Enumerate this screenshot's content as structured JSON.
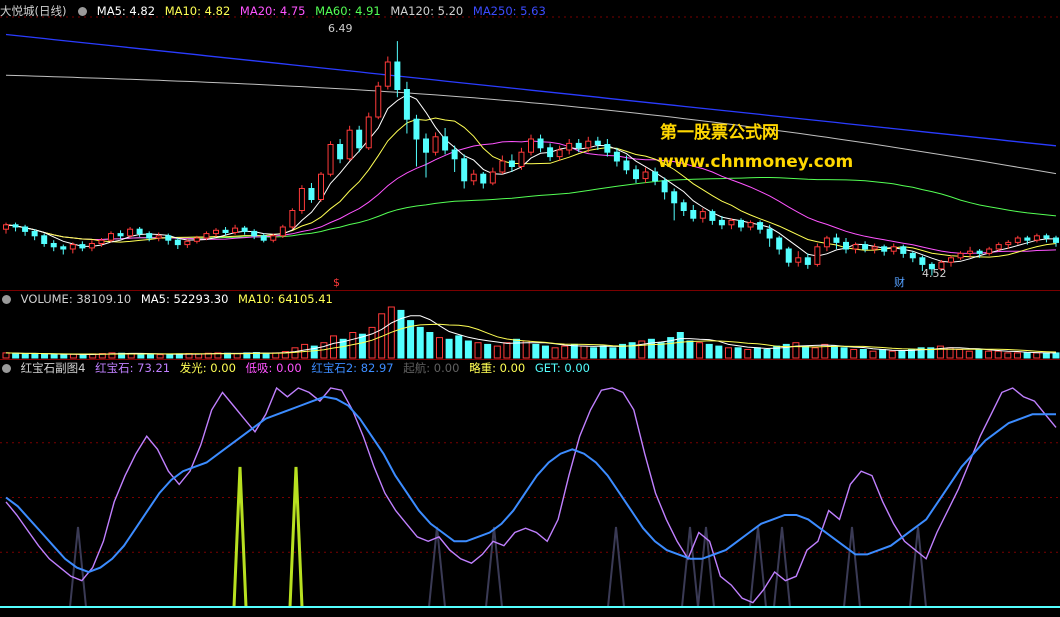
{
  "colors": {
    "background": "#000000",
    "up": "#ff3a3a",
    "down": "#54ffff",
    "ma5": "#ffffff",
    "ma10": "#ffff54",
    "ma20": "#ff54ff",
    "ma60": "#54ff54",
    "ma120": "#c0c0c0",
    "ma250": "#2a3cff"
  },
  "icons": {
    "legend_dot": "circle-icon"
  },
  "main": {
    "title": "大悦城(日线)",
    "legend": [
      {
        "label": "MA5: 4.82",
        "color": "#ffffff"
      },
      {
        "label": "MA10: 4.82",
        "color": "#ffff54"
      },
      {
        "label": "MA20: 4.75",
        "color": "#ff54ff"
      },
      {
        "label": "MA60: 4.91",
        "color": "#54ff54"
      },
      {
        "label": "MA120: 5.20",
        "color": "#d0d0d0"
      },
      {
        "label": "MA250: 5.63",
        "color": "#3c4cff"
      }
    ],
    "high_label": "6.49",
    "low_label": "4.52",
    "marker_s": "$",
    "marker_cai": "财",
    "watermark_cn": "第一股票公式网",
    "watermark_url": "www.chnmoney.com"
  },
  "volume": {
    "legend": [
      {
        "label": "VOLUME: 38109.10",
        "color": "#d0d0d0"
      },
      {
        "label": "MA5: 52293.30",
        "color": "#ffffff"
      },
      {
        "label": "MA10: 64105.41",
        "color": "#ffff54"
      }
    ]
  },
  "indicator": {
    "legend": [
      {
        "label": "红宝石副图4",
        "color": "#d0d0d0"
      },
      {
        "label": "红宝石: 73.21",
        "color": "#c080ff"
      },
      {
        "label": "发光: 0.00",
        "color": "#ffff54"
      },
      {
        "label": "低吸: 0.00",
        "color": "#ff54ff"
      },
      {
        "label": "红宝石2: 82.97",
        "color": "#3c8cff"
      },
      {
        "label": "起航: 0.00",
        "color": "#606060"
      },
      {
        "label": "略重: 0.00",
        "color": "#ffff54"
      },
      {
        "label": "GET: 0.00",
        "color": "#54ffff"
      }
    ]
  },
  "chart_data": [
    {
      "type": "candlestick",
      "title": "大悦城(日线)",
      "ylim": [
        4.3,
        6.7
      ],
      "annotations": {
        "max": 6.49,
        "min": 4.52
      },
      "candles": [
        [
          4.78,
          4.82,
          4.74,
          4.84
        ],
        [
          4.82,
          4.8,
          4.76,
          4.84
        ],
        [
          4.8,
          4.76,
          4.72,
          4.82
        ],
        [
          4.76,
          4.72,
          4.68,
          4.78
        ],
        [
          4.72,
          4.65,
          4.62,
          4.74
        ],
        [
          4.65,
          4.62,
          4.58,
          4.68
        ],
        [
          4.62,
          4.6,
          4.55,
          4.64
        ],
        [
          4.6,
          4.64,
          4.56,
          4.66
        ],
        [
          4.64,
          4.61,
          4.58,
          4.67
        ],
        [
          4.61,
          4.65,
          4.58,
          4.68
        ],
        [
          4.65,
          4.68,
          4.62,
          4.7
        ],
        [
          4.68,
          4.74,
          4.66,
          4.76
        ],
        [
          4.74,
          4.72,
          4.69,
          4.77
        ],
        [
          4.72,
          4.78,
          4.7,
          4.8
        ],
        [
          4.78,
          4.74,
          4.71,
          4.8
        ],
        [
          4.74,
          4.7,
          4.67,
          4.76
        ],
        [
          4.7,
          4.72,
          4.67,
          4.75
        ],
        [
          4.72,
          4.68,
          4.64,
          4.74
        ],
        [
          4.68,
          4.64,
          4.6,
          4.7
        ],
        [
          4.64,
          4.67,
          4.61,
          4.69
        ],
        [
          4.67,
          4.7,
          4.65,
          4.72
        ],
        [
          4.7,
          4.74,
          4.68,
          4.76
        ],
        [
          4.74,
          4.77,
          4.71,
          4.79
        ],
        [
          4.77,
          4.75,
          4.72,
          4.8
        ],
        [
          4.75,
          4.79,
          4.73,
          4.82
        ],
        [
          4.79,
          4.76,
          4.73,
          4.81
        ],
        [
          4.76,
          4.72,
          4.69,
          4.78
        ],
        [
          4.72,
          4.68,
          4.66,
          4.74
        ],
        [
          4.68,
          4.72,
          4.66,
          4.74
        ],
        [
          4.72,
          4.8,
          4.7,
          4.82
        ],
        [
          4.8,
          4.95,
          4.78,
          4.97
        ],
        [
          4.95,
          5.15,
          4.92,
          5.18
        ],
        [
          5.15,
          5.05,
          5.02,
          5.2
        ],
        [
          5.05,
          5.28,
          5.03,
          5.3
        ],
        [
          5.28,
          5.55,
          5.26,
          5.58
        ],
        [
          5.55,
          5.42,
          5.38,
          5.6
        ],
        [
          5.42,
          5.68,
          5.4,
          5.72
        ],
        [
          5.68,
          5.52,
          5.48,
          5.72
        ],
        [
          5.52,
          5.8,
          5.5,
          5.84
        ],
        [
          5.8,
          6.08,
          5.78,
          6.12
        ],
        [
          6.08,
          6.3,
          6.05,
          6.35
        ],
        [
          6.3,
          6.05,
          5.98,
          6.49
        ],
        [
          6.05,
          5.78,
          5.65,
          6.12
        ],
        [
          5.78,
          5.6,
          5.35,
          5.82
        ],
        [
          5.6,
          5.48,
          5.25,
          5.65
        ],
        [
          5.48,
          5.62,
          5.45,
          5.66
        ],
        [
          5.62,
          5.5,
          5.46,
          5.7
        ],
        [
          5.5,
          5.42,
          5.3,
          5.54
        ],
        [
          5.42,
          5.22,
          5.15,
          5.46
        ],
        [
          5.22,
          5.28,
          5.18,
          5.32
        ],
        [
          5.28,
          5.2,
          5.15,
          5.3
        ],
        [
          5.2,
          5.3,
          5.18,
          5.34
        ],
        [
          5.3,
          5.4,
          5.28,
          5.45
        ],
        [
          5.4,
          5.35,
          5.3,
          5.46
        ],
        [
          5.35,
          5.48,
          5.32,
          5.52
        ],
        [
          5.48,
          5.6,
          5.45,
          5.64
        ],
        [
          5.6,
          5.52,
          5.48,
          5.64
        ],
        [
          5.52,
          5.44,
          5.4,
          5.56
        ],
        [
          5.44,
          5.5,
          5.4,
          5.54
        ],
        [
          5.5,
          5.56,
          5.46,
          5.6
        ],
        [
          5.56,
          5.52,
          5.48,
          5.6
        ],
        [
          5.52,
          5.58,
          5.48,
          5.62
        ],
        [
          5.58,
          5.55,
          5.5,
          5.62
        ],
        [
          5.55,
          5.48,
          5.44,
          5.6
        ],
        [
          5.48,
          5.4,
          5.35,
          5.52
        ],
        [
          5.4,
          5.32,
          5.28,
          5.45
        ],
        [
          5.32,
          5.24,
          5.2,
          5.36
        ],
        [
          5.24,
          5.3,
          5.2,
          5.34
        ],
        [
          5.3,
          5.22,
          5.18,
          5.34
        ],
        [
          5.22,
          5.12,
          5.05,
          5.25
        ],
        [
          5.12,
          5.02,
          4.86,
          5.15
        ],
        [
          5.02,
          4.95,
          4.9,
          5.05
        ],
        [
          4.95,
          4.88,
          4.85,
          5.0
        ],
        [
          4.88,
          4.94,
          4.84,
          4.97
        ],
        [
          4.94,
          4.86,
          4.82,
          4.96
        ],
        [
          4.86,
          4.82,
          4.78,
          4.9
        ],
        [
          4.82,
          4.86,
          4.78,
          4.88
        ],
        [
          4.86,
          4.8,
          4.76,
          4.88
        ],
        [
          4.8,
          4.84,
          4.77,
          4.86
        ],
        [
          4.84,
          4.78,
          4.74,
          4.86
        ],
        [
          4.78,
          4.7,
          4.62,
          4.82
        ],
        [
          4.7,
          4.6,
          4.55,
          4.72
        ],
        [
          4.6,
          4.48,
          4.44,
          4.62
        ],
        [
          4.48,
          4.52,
          4.44,
          4.58
        ],
        [
          4.52,
          4.46,
          4.42,
          4.56
        ],
        [
          4.46,
          4.62,
          4.44,
          4.65
        ],
        [
          4.62,
          4.7,
          4.58,
          4.72
        ],
        [
          4.7,
          4.66,
          4.6,
          4.74
        ],
        [
          4.66,
          4.6,
          4.56,
          4.7
        ],
        [
          4.6,
          4.64,
          4.56,
          4.66
        ],
        [
          4.64,
          4.6,
          4.57,
          4.67
        ],
        [
          4.6,
          4.62,
          4.56,
          4.65
        ],
        [
          4.62,
          4.58,
          4.54,
          4.64
        ],
        [
          4.58,
          4.62,
          4.55,
          4.65
        ],
        [
          4.62,
          4.56,
          4.52,
          4.64
        ],
        [
          4.56,
          4.52,
          4.48,
          4.58
        ],
        [
          4.52,
          4.46,
          4.4,
          4.54
        ],
        [
          4.46,
          4.42,
          4.36,
          4.48
        ],
        [
          4.42,
          4.48,
          4.4,
          4.5
        ],
        [
          4.48,
          4.52,
          4.44,
          4.54
        ],
        [
          4.52,
          4.56,
          4.5,
          4.58
        ],
        [
          4.56,
          4.58,
          4.52,
          4.62
        ],
        [
          4.58,
          4.56,
          4.52,
          4.6
        ],
        [
          4.56,
          4.6,
          4.54,
          4.62
        ],
        [
          4.6,
          4.64,
          4.58,
          4.66
        ],
        [
          4.64,
          4.66,
          4.6,
          4.68
        ],
        [
          4.66,
          4.7,
          4.64,
          4.72
        ],
        [
          4.7,
          4.68,
          4.64,
          4.72
        ],
        [
          4.68,
          4.72,
          4.66,
          4.74
        ],
        [
          4.72,
          4.7,
          4.66,
          4.74
        ],
        [
          4.7,
          4.66,
          4.62,
          4.72
        ]
      ]
    },
    {
      "type": "bar",
      "title": "VOLUME",
      "values": [
        30,
        28,
        24,
        26,
        22,
        20,
        18,
        22,
        20,
        24,
        26,
        30,
        28,
        26,
        24,
        22,
        20,
        22,
        24,
        26,
        24,
        28,
        30,
        28,
        26,
        30,
        32,
        28,
        30,
        38,
        60,
        80,
        70,
        90,
        130,
        110,
        150,
        140,
        180,
        260,
        300,
        280,
        220,
        180,
        150,
        120,
        110,
        130,
        100,
        90,
        80,
        70,
        90,
        110,
        100,
        80,
        70,
        60,
        70,
        80,
        70,
        60,
        70,
        60,
        80,
        90,
        100,
        110,
        90,
        120,
        150,
        100,
        90,
        80,
        70,
        60,
        60,
        50,
        60,
        50,
        70,
        80,
        90,
        70,
        60,
        80,
        70,
        60,
        50,
        50,
        40,
        50,
        40,
        40,
        50,
        60,
        60,
        70,
        60,
        50,
        40,
        50,
        40,
        40,
        30,
        30,
        30,
        30,
        30,
        30
      ],
      "ma5": [
        52293.3
      ],
      "ma10": [
        64105.41
      ]
    },
    {
      "type": "line",
      "title": "红宝石副图4",
      "ylim": [
        0,
        100
      ],
      "series": [
        {
          "name": "红宝石",
          "values": [
            48,
            42,
            35,
            28,
            22,
            18,
            14,
            12,
            18,
            30,
            48,
            60,
            70,
            78,
            72,
            62,
            56,
            62,
            74,
            90,
            98,
            92,
            86,
            80,
            88,
            100,
            96,
            100,
            98,
            94,
            100,
            99,
            90,
            78,
            64,
            52,
            44,
            38,
            32,
            30,
            32,
            26,
            22,
            20,
            24,
            30,
            28,
            34,
            36,
            34,
            30,
            40,
            60,
            78,
            90,
            99,
            100,
            98,
            90,
            70,
            52,
            40,
            30,
            22,
            34,
            30,
            14,
            10,
            4,
            2,
            8,
            16,
            12,
            14,
            26,
            30,
            44,
            40,
            56,
            62,
            60,
            48,
            38,
            30,
            26,
            22,
            34,
            44,
            54,
            66,
            78,
            88,
            98,
            100,
            96,
            94,
            88,
            82
          ]
        },
        {
          "name": "红宝石2",
          "values": [
            50,
            46,
            40,
            34,
            28,
            22,
            18,
            16,
            18,
            22,
            28,
            36,
            44,
            52,
            58,
            62,
            64,
            66,
            70,
            74,
            78,
            82,
            86,
            88,
            90,
            92,
            94,
            96,
            95,
            92,
            86,
            78,
            70,
            60,
            52,
            44,
            38,
            34,
            30,
            30,
            32,
            34,
            38,
            44,
            52,
            60,
            66,
            70,
            72,
            70,
            66,
            60,
            52,
            44,
            36,
            30,
            26,
            24,
            22,
            22,
            24,
            26,
            30,
            34,
            38,
            40,
            42,
            42,
            40,
            36,
            32,
            28,
            24,
            24,
            26,
            28,
            32,
            36,
            40,
            48,
            56,
            64,
            70,
            76,
            80,
            84,
            86,
            88,
            88,
            88
          ]
        },
        {
          "name": "发光",
          "values": [
            0,
            0,
            0,
            0,
            0,
            0,
            0,
            0,
            0,
            0,
            0,
            0,
            0,
            0,
            0,
            0,
            0,
            0,
            0,
            0,
            0,
            0,
            0,
            0,
            0,
            0,
            0,
            0,
            0,
            0,
            0,
            0,
            0,
            0,
            0,
            0,
            0,
            0,
            0,
            0,
            0,
            0,
            0,
            0,
            0,
            0,
            0,
            0,
            0,
            0,
            0,
            0,
            0,
            0,
            0,
            0,
            0,
            0,
            0,
            0,
            0
          ]
        },
        {
          "name": "起航",
          "values": [
            0,
            0,
            0,
            0,
            0,
            0,
            0,
            0,
            0,
            0,
            0,
            0,
            0,
            0,
            0,
            0,
            0,
            0,
            0,
            0,
            0,
            0,
            0,
            0,
            0,
            0,
            0,
            0,
            0,
            0,
            0,
            0,
            0,
            0,
            0,
            0,
            0,
            0,
            0,
            0,
            0,
            0,
            0,
            0,
            0,
            0,
            0,
            0,
            0,
            0,
            0,
            0,
            0,
            0,
            0,
            0,
            0,
            0,
            0,
            0,
            0
          ]
        }
      ],
      "spikes_glow": [
        240,
        296
      ],
      "spikes_launch": [
        78,
        437,
        494,
        616,
        690,
        706,
        758,
        782,
        852,
        918
      ]
    }
  ]
}
